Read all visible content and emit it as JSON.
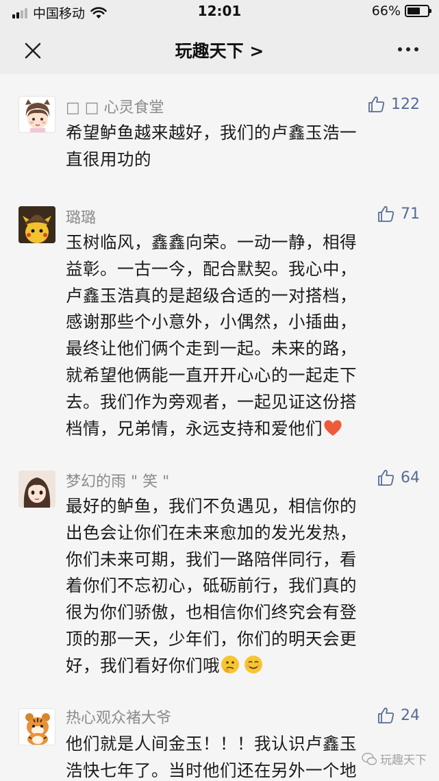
{
  "status_bar": {
    "carrier": "中国移动",
    "time": "12:01",
    "battery": "66%",
    "battery_level": 0.66
  },
  "nav": {
    "title": "玩趣天下 >"
  },
  "comments": [
    {
      "nickname": "□ □ 心灵食堂",
      "likes": "122",
      "lines": [
        "希望鲈鱼越来越好，我们的卢鑫玉浩一",
        "直很用功的"
      ],
      "avatar": "girl-cartoon-avatar"
    },
    {
      "nickname": "璐璐",
      "likes": "71",
      "lines": [
        "玉树临风，鑫鑫向荣。一动一静，相得",
        "益彰。一古一今，配合默契。我心中，",
        "卢鑫玉浩真的是超级合适的一对搭档，",
        "感谢那些个小意外，小偶然，小插曲，",
        "最终让他们俩个走到一起。未来的路，",
        "就希望他俩能一直开开心心的一起走下",
        "去。我们作为旁观者，一起见证这份搭",
        "档情，兄弟情，永远支持和爱他们"
      ],
      "avatar": "pikachu-detective-avatar",
      "end_emoji": "heart-emoji"
    },
    {
      "nickname": "梦幻的雨 \" 笑 \"",
      "likes": "64",
      "lines": [
        "最好的鲈鱼，我们不负遇见，相信你的",
        "出色会让你们在未来愈加的发光发热，",
        "你们未来可期，我们一路陪伴同行，看",
        "着你们不忘初心，砥砺前行，我们真的",
        "很为你们骄傲，也相信你们终究会有登",
        "顶的那一天，少年们，你们的明天会更",
        "好，我们看好你们哦"
      ],
      "avatar": "anime-girl-avatar",
      "end_emojis": [
        "thinking-emoji",
        "smile-emoji"
      ]
    },
    {
      "nickname": "热心观众褚大爷",
      "likes": "24",
      "lines": [
        "他们就是人间金玉！！！我认识卢鑫玉",
        "浩快七年了。当时他们还在另外一个地"
      ],
      "avatar": "tiger-avatar"
    }
  ],
  "watermark": "玩趣天下"
}
